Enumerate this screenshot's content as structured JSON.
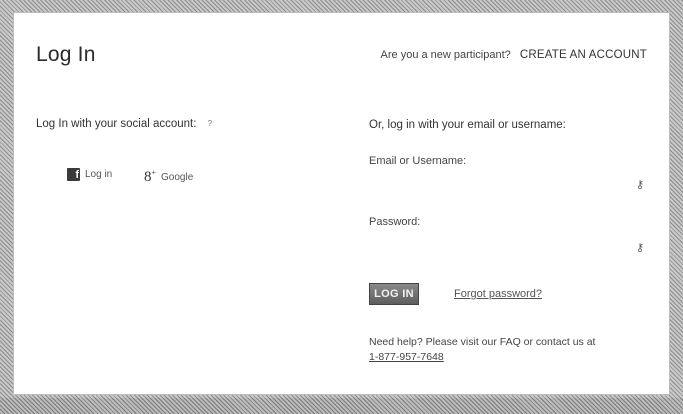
{
  "header": {
    "title": "Log In",
    "new_participant_prompt": "Are you a new participant?",
    "create_account_link": "CREATE AN ACCOUNT"
  },
  "social": {
    "heading": "Log In with your social account:",
    "help_icon": "?",
    "buttons": [
      {
        "label": "Log in",
        "icon": "facebook-icon"
      },
      {
        "label": "Google",
        "icon": "google-plus-icon"
      }
    ]
  },
  "email_login": {
    "heading": "Or, log in with your email or username:",
    "email_label": "Email or Username:",
    "email_value": "",
    "password_label": "Password:",
    "password_value": "",
    "login_button": "LOG IN",
    "forgot_link": "Forgot password?",
    "help_text": "Need help? Please visit our FAQ or contact us at",
    "phone": "1-877-957-7648"
  }
}
